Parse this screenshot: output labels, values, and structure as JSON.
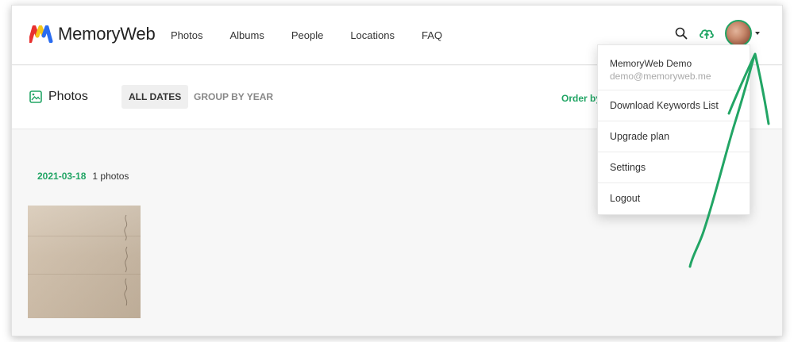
{
  "app": {
    "name": "MemoryWeb"
  },
  "nav": {
    "links": [
      "Photos",
      "Albums",
      "People",
      "Locations",
      "FAQ"
    ],
    "icons": [
      "search-icon",
      "cloud-upload-icon",
      "avatar",
      "caret-down-icon"
    ]
  },
  "subbar": {
    "title": "Photos",
    "tabs": {
      "all_dates": "ALL DATES",
      "group_by_year": "GROUP BY YEAR"
    },
    "order_label": "Order by"
  },
  "content": {
    "groups": [
      {
        "date": "2021-03-18",
        "count": "1 photos"
      }
    ]
  },
  "user_menu": {
    "name": "MemoryWeb Demo",
    "email": "demo@memoryweb.me",
    "items": [
      "Download Keywords List",
      "Upgrade plan",
      "Settings",
      "Logout"
    ]
  },
  "colors": {
    "accent": "#22a565",
    "logo_red": "#e8312f",
    "logo_blue": "#2a6cf0",
    "logo_yellow": "#f5c518"
  }
}
